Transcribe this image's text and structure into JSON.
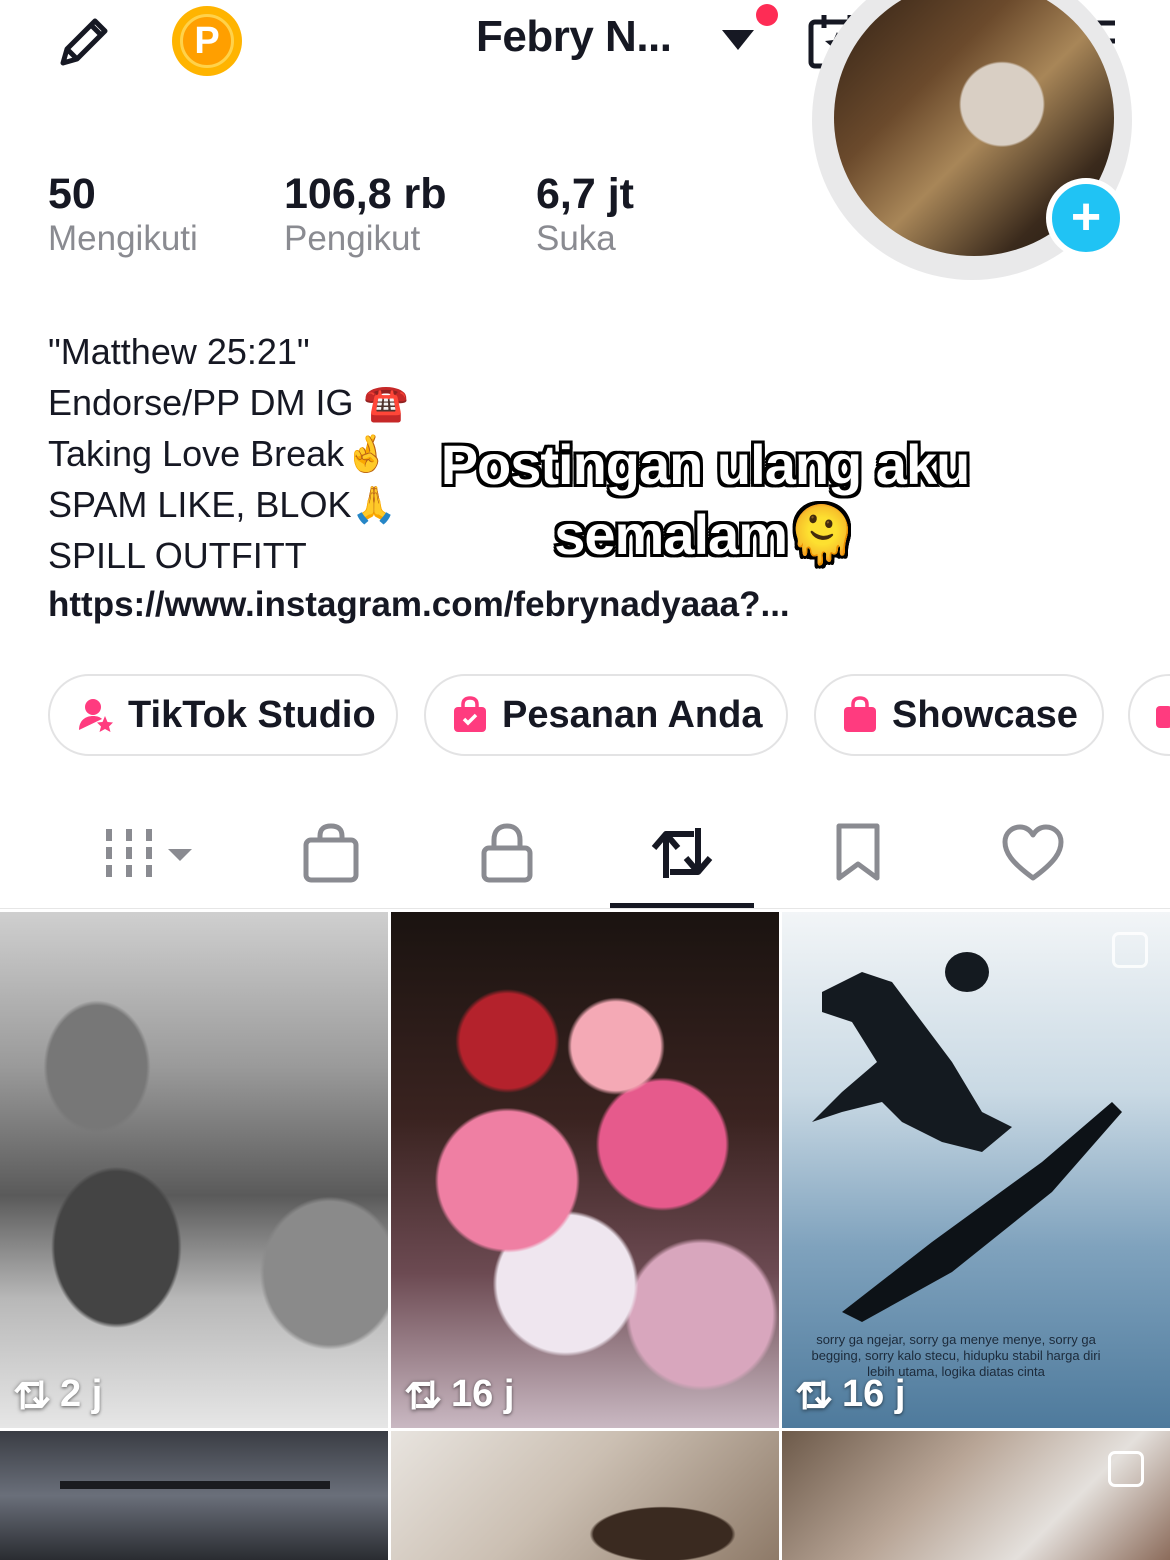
{
  "header": {
    "username": "Febry N...",
    "coin_letter": "P"
  },
  "stats": [
    {
      "value": "50",
      "label": "Mengikuti"
    },
    {
      "value": "106,8 rb",
      "label": "Pengikut"
    },
    {
      "value": "6,7 jt",
      "label": "Suka"
    }
  ],
  "bio": {
    "lines": [
      "\"Matthew 25:21\"",
      "Endorse/PP DM IG ☎️",
      "Taking Love Break🤞",
      "SPAM LIKE, BLOK🙏",
      "SPILL OUTFITT"
    ],
    "link": "https://www.instagram.com/febrynadyaaa?..."
  },
  "overlay": {
    "line1": "Postingan ulang aku",
    "line2": "semalam🫠"
  },
  "chips": [
    {
      "label": "TikTok Studio"
    },
    {
      "label": "Pesanan Anda"
    },
    {
      "label": "Showcase"
    }
  ],
  "grid": [
    {
      "count": "2 j"
    },
    {
      "count": "16 j"
    },
    {
      "count": "16 j",
      "caption": "sorry ga ngejar, sorry ga menye menye, sorry ga begging, sorry kalo stecu, hidupku stabil harga diri lebih utama, logika diatas cinta"
    }
  ],
  "colors": {
    "accent_red": "#fe2c55",
    "avatar_plus": "#20c3f4",
    "coin": "#ffb400",
    "chip_pink": "#ff3b7f"
  }
}
